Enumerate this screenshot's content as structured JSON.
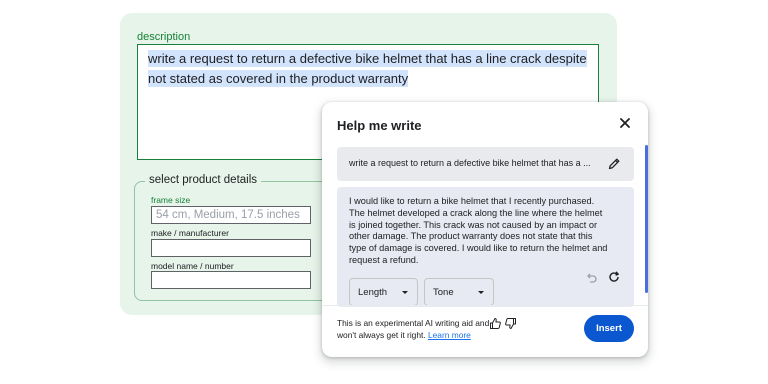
{
  "form": {
    "description_label": "description",
    "description_value": "write a request to return a defective bike helmet that has a line crack despite not stated as covered in the product warranty",
    "details_legend": "select product details",
    "frame_size_label": "frame size",
    "frame_size_placeholder": "54 cm, Medium, 17.5 inches",
    "make_label": "make / manufacturer",
    "model_label": "model name / number"
  },
  "dialog": {
    "title": "Help me write",
    "prompt_text": "write a request to return a defective bike helmet that has a ...",
    "response_text": "I would like to return a bike helmet that I recently purchased. The helmet developed a crack along the line where the helmet is joined together. This crack was not caused by an impact or other damage. The product warranty does not state that this type of damage is covered. I would like to return the helmet and request a refund.",
    "length_label": "Length",
    "tone_label": "Tone",
    "disclaimer_text": "This is an experimental AI writing aid and won't always get it right.",
    "learn_more_label": "Learn more",
    "insert_label": "Insert",
    "icons": [
      "close-icon",
      "edit-icon",
      "undo-icon",
      "refresh-icon",
      "thumb-up-icon",
      "thumb-down-icon",
      "chevron-down-icon"
    ]
  },
  "colors": {
    "form_background": "#e6f4ea",
    "accent_green": "#188038",
    "selection_highlight": "#d2e3fc",
    "insert_button": "#0b57d0",
    "link": "#1a73e8"
  }
}
